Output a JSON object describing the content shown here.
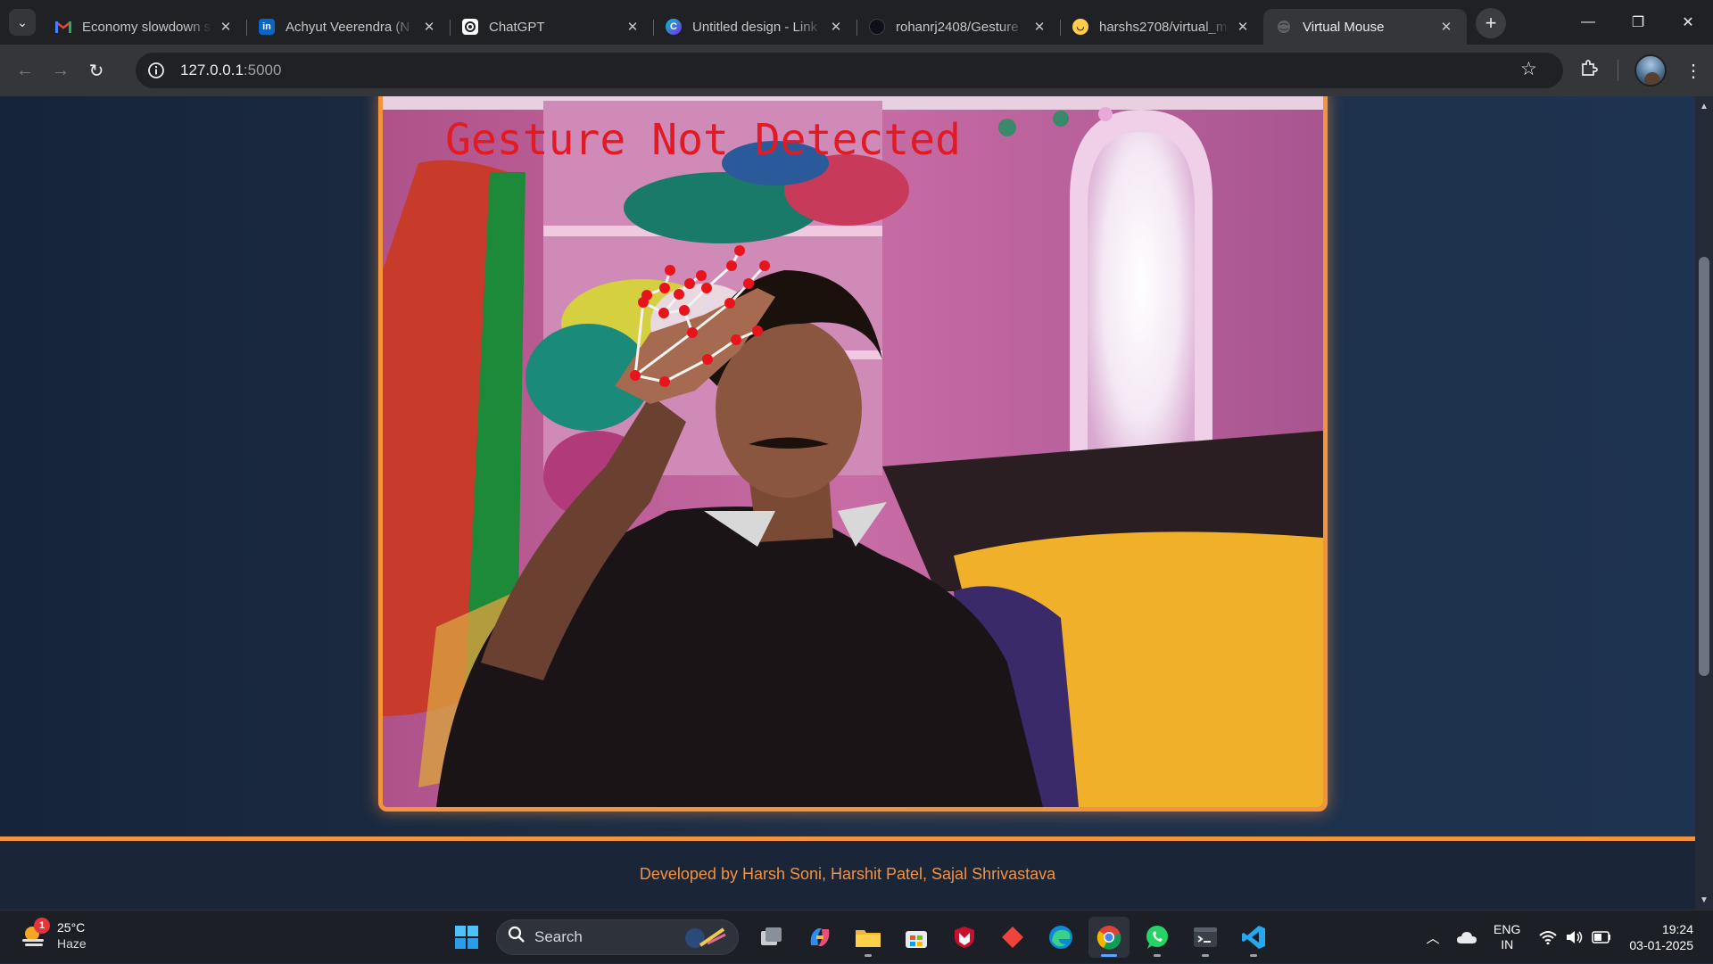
{
  "tabs": [
    {
      "title": "Economy slowdown s",
      "icon": "gmail-icon",
      "color": "#ea4335"
    },
    {
      "title": "Achyut Veerendra (N",
      "icon": "linkedin-icon",
      "color": "#0a66c2"
    },
    {
      "title": "ChatGPT",
      "icon": "chatgpt-icon",
      "color": "#ffffff"
    },
    {
      "title": "Untitled design - Link",
      "icon": "canva-icon",
      "color": "#00c4cc"
    },
    {
      "title": "rohanrj2408/Gesture",
      "icon": "github-icon",
      "color": "#24292f"
    },
    {
      "title": "harshs2708/virtual_m",
      "icon": "hugging-face-icon",
      "color": "#ffcc4d"
    },
    {
      "title": "Virtual Mouse",
      "icon": "globe-icon",
      "color": "#9aa0a6",
      "active": true
    }
  ],
  "address": {
    "host": "127.0.0.1",
    "port": ":5000"
  },
  "video": {
    "overlay_text": "Gesture Not Detected",
    "overlay_color": "#e01b24",
    "landmark_color": "#e8141c"
  },
  "footer": {
    "credit": "Developed by Harsh Soni, Harshit Patel, Sajal Shrivastava"
  },
  "accent": "#f5923e",
  "taskbar": {
    "weather": {
      "temp": "25°C",
      "condition": "Haze",
      "badge": "1"
    },
    "search_label": "Search",
    "lang": {
      "line1": "ENG",
      "line2": "IN"
    },
    "clock": {
      "time": "19:24",
      "date": "03-01-2025"
    }
  }
}
